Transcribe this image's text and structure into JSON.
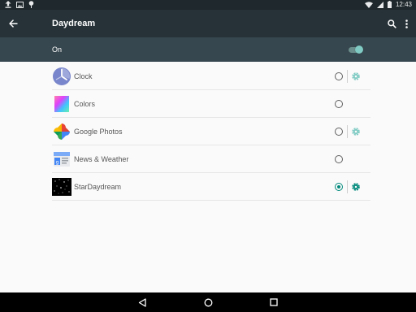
{
  "status_bar": {
    "time": "12:43",
    "icons": [
      "upload-icon",
      "image-icon",
      "pin-icon",
      "wifi-icon",
      "signal-icon",
      "battery-icon"
    ]
  },
  "app_bar": {
    "title": "Daydream",
    "icons": [
      "back-arrow-icon",
      "search-icon",
      "more-vert-icon"
    ]
  },
  "master_switch": {
    "label": "On",
    "state": "on"
  },
  "items": [
    {
      "label": "Clock",
      "icon": "clock-app-icon",
      "selected": false,
      "has_settings": true,
      "settings_enabled": false
    },
    {
      "label": "Colors",
      "icon": "colors-app-icon",
      "selected": false,
      "has_settings": false
    },
    {
      "label": "Google Photos",
      "icon": "google-photos-icon",
      "selected": false,
      "has_settings": true,
      "settings_enabled": false
    },
    {
      "label": "News & Weather",
      "icon": "news-weather-icon",
      "selected": false,
      "has_settings": false
    },
    {
      "label": "StarDaydream",
      "icon": "stardaydream-icon",
      "selected": true,
      "has_settings": true,
      "settings_enabled": true
    }
  ],
  "nav_bar": {
    "icons": [
      "nav-back-icon",
      "nav-home-icon",
      "nav-recents-icon"
    ]
  },
  "colors": {
    "status_bar": "#1f282c",
    "app_bar": "#263238",
    "switch_bar": "#37474f",
    "accent": "#00897b",
    "accent_light": "#80cbc4"
  }
}
